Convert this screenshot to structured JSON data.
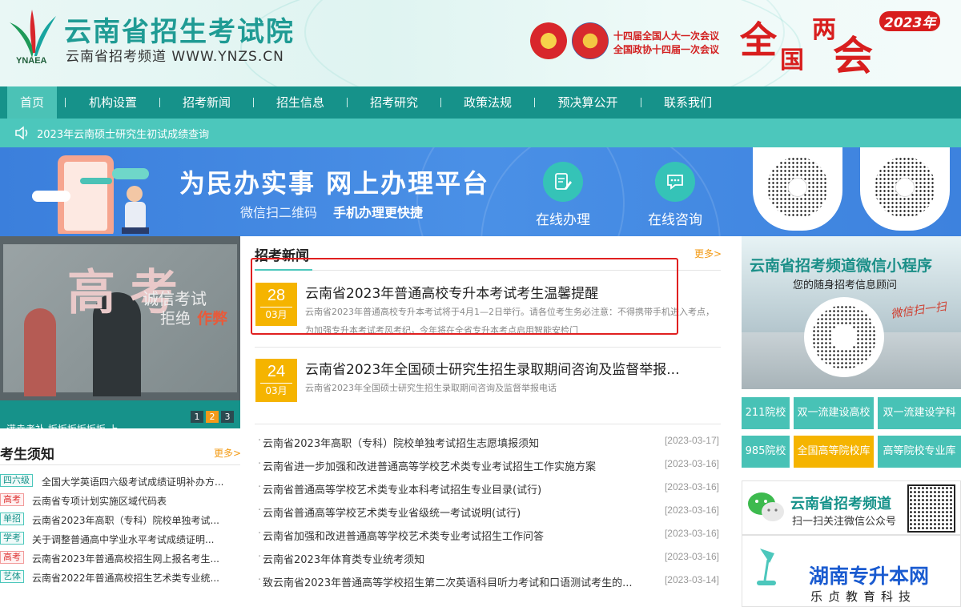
{
  "header": {
    "logo_text": "YNAEA",
    "title": "云南省招生考试院",
    "subtitle": "云南省招考频道  WWW.YNZS.CN",
    "congress_line1": "十四届全国人大一次会议",
    "congress_line2": "全国政协十四届一次会议",
    "lianghui": [
      "全",
      "国",
      "两",
      "会"
    ],
    "year_badge": "2023年"
  },
  "nav": {
    "items": [
      {
        "label": "首页",
        "active": true
      },
      {
        "label": "机构设置",
        "active": false
      },
      {
        "label": "招考新闻",
        "active": false
      },
      {
        "label": "招生信息",
        "active": false
      },
      {
        "label": "招考研究",
        "active": false
      },
      {
        "label": "政策法规",
        "active": false
      },
      {
        "label": "预决算公开",
        "active": false
      },
      {
        "label": "联系我们",
        "active": false
      }
    ]
  },
  "notice": {
    "icon": "speaker-icon",
    "text": "2023年云南硕士研究生初试成绩查询"
  },
  "banner": {
    "title": "为民办实事  网上办理平台",
    "sub1": "微信扫二维码",
    "sub2": "手机办理更快捷",
    "services": [
      {
        "label": "在线办理",
        "icon": "edit-document-icon"
      },
      {
        "label": "在线咨询",
        "icon": "chat-bubble-icon"
      }
    ]
  },
  "slider": {
    "image_text_big": [
      "高",
      "考"
    ],
    "image_text_line1": "诚信考试",
    "image_text_line2": "拒绝",
    "image_text_line2_emph": "作弊",
    "caption": "满幸考补 坂坂坂坂坂坂 上",
    "pages": [
      "1",
      "2",
      "3"
    ],
    "active_page": 2
  },
  "kaosheng": {
    "title": "考生须知",
    "more": "更多>",
    "items": [
      {
        "tag": "四六级",
        "red": false,
        "text": "全国大学英语四六级考试成绩证明补办方..."
      },
      {
        "tag": "高考",
        "red": true,
        "text": "云南省专项计划实施区域代码表"
      },
      {
        "tag": "单招",
        "red": false,
        "text": "云南省2023年高职（专科）院校单独考试..."
      },
      {
        "tag": "学考",
        "red": false,
        "text": "关于调整普通高中学业水平考试成绩证明..."
      },
      {
        "tag": "高考",
        "red": true,
        "text": "云南省2023年普通高校招生网上报名考生..."
      },
      {
        "tag": "艺体",
        "red": false,
        "text": "云南省2022年普通高校招生艺术类专业统..."
      }
    ]
  },
  "news": {
    "title": "招考新闻",
    "more": "更多>",
    "featured": [
      {
        "day": "28",
        "month": "03月",
        "title": "云南省2023年普通高校专升本考试考生温馨提醒",
        "summary": "云南省2023年普通高校专升本考试将于4月1—2日举行。请各位考生务必注意：不得携带手机进入考点，为加强专升本考试考风考纪，今年将在全省专升本考点启用智能安检门"
      },
      {
        "day": "24",
        "month": "03月",
        "title": "云南省2023年全国硕士研究生招生录取期间咨询及监督举报...",
        "summary": "云南省2023年全国硕士研究生招生录取期间咨询及监督举报电话"
      }
    ],
    "list": [
      {
        "text": "云南省2023年高职（专科）院校单独考试招生志愿填报须知",
        "date": "[2023-03-17]"
      },
      {
        "text": "云南省进一步加强和改进普通高等学校艺术类专业考试招生工作实施方案",
        "date": "[2023-03-16]"
      },
      {
        "text": "云南省普通高等学校艺术类专业本科考试招生专业目录(试行)",
        "date": "[2023-03-16]"
      },
      {
        "text": "云南省普通高等学校艺术类专业省级统一考试说明(试行)",
        "date": "[2023-03-16]"
      },
      {
        "text": "云南省加强和改进普通高等学校艺术类专业考试招生工作问答",
        "date": "[2023-03-16]"
      },
      {
        "text": "云南省2023年体育类专业统考须知",
        "date": "[2023-03-16]"
      },
      {
        "text": "致云南省2023年普通高等学校招生第二次英语科目听力考试和口语测试考生的...",
        "date": "[2023-03-14]"
      }
    ]
  },
  "mini_program": {
    "title": "云南省招考频道微信小程序",
    "subtitle": "您的随身招考信息顾问",
    "scan": "微信扫一扫"
  },
  "quick_links": [
    {
      "label": "211院校",
      "highlight": false
    },
    {
      "label": "双一流建设高校",
      "highlight": false
    },
    {
      "label": "双一流建设学科",
      "highlight": false
    },
    {
      "label": "985院校",
      "highlight": false
    },
    {
      "label": "全国高等院校库",
      "highlight": true
    },
    {
      "label": "高等院校专业库",
      "highlight": false
    }
  ],
  "wechat": {
    "title": "云南省招考频道",
    "subtitle": "扫一扫关注微信公众号"
  },
  "watermark": {
    "title": "湖南专升本网",
    "subtitle": "乐贞教育科技"
  }
}
